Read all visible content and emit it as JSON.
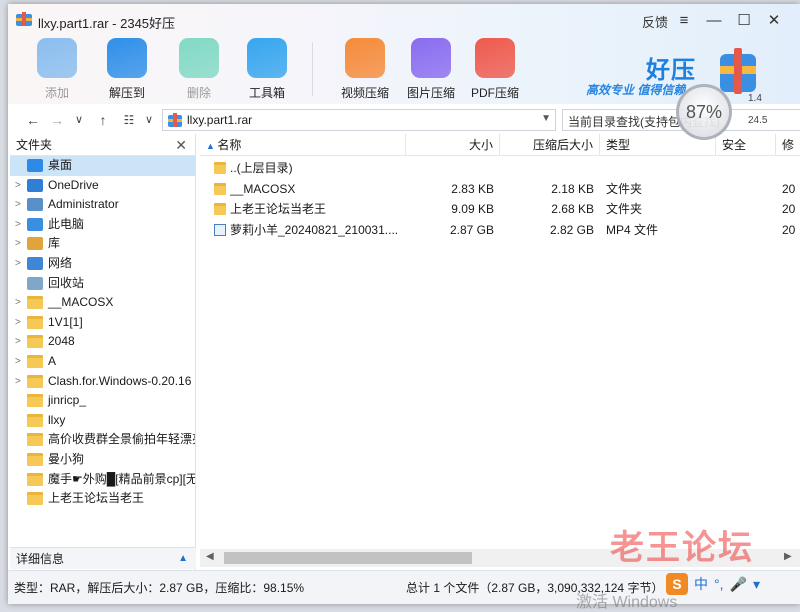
{
  "window": {
    "title": "llxy.part1.rar - 2345好压",
    "feedback": "反馈",
    "controls": [
      "≡",
      "—",
      "☐",
      "✕"
    ]
  },
  "toolbar": [
    {
      "label": "添加",
      "icon": "add-archive-icon",
      "disabled": true,
      "color": "#2f8fe8"
    },
    {
      "label": "解压到",
      "icon": "extract-to-icon",
      "disabled": false,
      "color": "#2f8fe8"
    },
    {
      "label": "删除",
      "icon": "recycle-delete-icon",
      "disabled": true,
      "color": "#22c29a"
    },
    {
      "label": "工具箱",
      "icon": "toolbox-icon",
      "disabled": false,
      "color": "#36a6ee"
    },
    {
      "label": "视频压缩",
      "icon": "video-compress-icon",
      "disabled": false,
      "color": "#f58b3a"
    },
    {
      "label": "图片压缩",
      "icon": "image-compress-icon",
      "disabled": false,
      "color": "#8a6cf0"
    },
    {
      "label": "PDF压缩",
      "icon": "pdf-compress-icon",
      "disabled": false,
      "color": "#ef5a4d"
    }
  ],
  "brand": {
    "name": "好压",
    "slogan": "高效专业  值得信赖",
    "accent": "#1d7fe0"
  },
  "overlay": {
    "gauge": "87%",
    "net_up": "1.4",
    "net_down": "24.5"
  },
  "address": {
    "path": "llxy.part1.rar",
    "search_placeholder": "当前目录查找(支持包内查找)"
  },
  "tree": {
    "header": "文件夹",
    "nodes": [
      {
        "label": "桌面",
        "icon": "desktop-icon",
        "caret": "",
        "selected": true
      },
      {
        "label": "OneDrive",
        "icon": "cloud-icon",
        "caret": ">",
        "selected": false
      },
      {
        "label": "Administrator",
        "icon": "user-icon",
        "caret": ">",
        "selected": false
      },
      {
        "label": "此电脑",
        "icon": "computer-icon",
        "caret": ">",
        "selected": false
      },
      {
        "label": "库",
        "icon": "library-icon",
        "caret": ">",
        "selected": false
      },
      {
        "label": "网络",
        "icon": "network-icon",
        "caret": ">",
        "selected": false
      },
      {
        "label": "回收站",
        "icon": "recycle-bin-icon",
        "caret": "",
        "selected": false
      },
      {
        "label": "__MACOSX",
        "icon": "folder-icon",
        "caret": ">",
        "selected": false
      },
      {
        "label": "1V1[1]",
        "icon": "folder-icon",
        "caret": ">",
        "selected": false
      },
      {
        "label": "2048",
        "icon": "folder-icon",
        "caret": ">",
        "selected": false
      },
      {
        "label": "A",
        "icon": "folder-icon",
        "caret": ">",
        "selected": false
      },
      {
        "label": "Clash.for.Windows-0.20.16",
        "icon": "folder-icon",
        "caret": ">",
        "selected": false
      },
      {
        "label": "jinricp_",
        "icon": "folder-icon",
        "caret": "",
        "selected": false
      },
      {
        "label": "llxy",
        "icon": "folder-icon",
        "caret": "",
        "selected": false
      },
      {
        "label": "高价收费群全景偷拍年轻漂亮",
        "icon": "folder-icon",
        "caret": "",
        "selected": false
      },
      {
        "label": "曼小狗",
        "icon": "folder-icon",
        "caret": "",
        "selected": false
      },
      {
        "label": "魔手☛外购█[精品前景cp][无",
        "icon": "folder-icon",
        "caret": "",
        "selected": false
      },
      {
        "label": "上老王论坛当老王",
        "icon": "folder-icon",
        "caret": "",
        "selected": false
      }
    ],
    "detail_label": "详细信息"
  },
  "list": {
    "columns": {
      "name": "名称",
      "size": "大小",
      "packed": "压缩后大小",
      "type": "类型",
      "security": "安全",
      "modified": "修"
    },
    "rows": [
      {
        "name": "..(上层目录)",
        "size": "",
        "packed": "",
        "type": "",
        "date": "",
        "icon": "folder-icon"
      },
      {
        "name": "__MACOSX",
        "size": "2.83 KB",
        "packed": "2.18 KB",
        "type": "文件夹",
        "date": "20",
        "icon": "folder-icon"
      },
      {
        "name": "上老王论坛当老王",
        "size": "9.09 KB",
        "packed": "2.68 KB",
        "type": "文件夹",
        "date": "20",
        "icon": "folder-icon"
      },
      {
        "name": "萝莉小羊_20240821_210031....",
        "size": "2.87 GB",
        "packed": "2.82 GB",
        "type": "MP4 文件",
        "date": "20",
        "icon": "video-file-icon"
      }
    ]
  },
  "status": {
    "left": "类型：RAR，解压后大小：2.87 GB，压缩比：98.15%",
    "right": "总计 1 个文件（2.87 GB，3,090,332,124 字节）"
  },
  "watermark": "老王论坛",
  "activation": "激活 Windows",
  "ime": {
    "logo": "S",
    "mode": "中",
    "punct": "°,",
    "mic": "🎤",
    "more": "▾"
  }
}
